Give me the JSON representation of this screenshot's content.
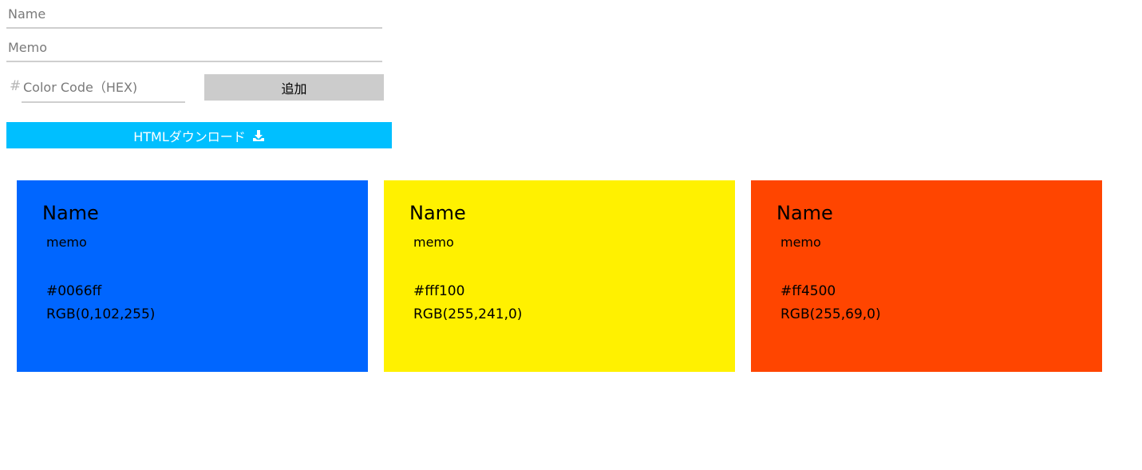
{
  "form": {
    "name_placeholder": "Name",
    "memo_placeholder": "Memo",
    "hash_prefix": "#",
    "color_placeholder": "Color Code（HEX)",
    "add_label": "追加",
    "download_label": "HTMLダウンロード",
    "download_icon": "download-icon"
  },
  "cards": [
    {
      "name": "Name",
      "memo": "memo",
      "hex": "#0066ff",
      "rgb": "RGB(0,102,255)",
      "color": "#0066ff"
    },
    {
      "name": "Name",
      "memo": "memo",
      "hex": "#fff100",
      "rgb": "RGB(255,241,0)",
      "color": "#fff100"
    },
    {
      "name": "Name",
      "memo": "memo",
      "hex": "#ff4500",
      "rgb": "RGB(255,69,0)",
      "color": "#ff4500"
    }
  ],
  "colors": {
    "add_button": "#cccccc",
    "download_button": "#00bfff"
  }
}
